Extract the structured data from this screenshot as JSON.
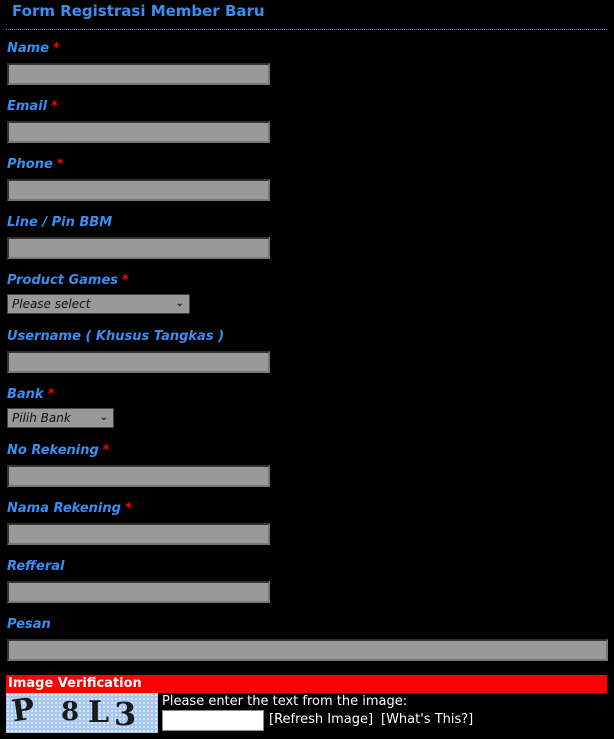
{
  "header": {
    "title": "Form Registrasi Member Baru"
  },
  "required_marker": "*",
  "fields": {
    "name": {
      "label": "Name",
      "required": true,
      "value": ""
    },
    "email": {
      "label": "Email",
      "required": true,
      "value": ""
    },
    "phone": {
      "label": "Phone",
      "required": true,
      "value": ""
    },
    "line_bbm": {
      "label": "Line / Pin BBM",
      "required": false,
      "value": ""
    },
    "product": {
      "label": "Product Games",
      "required": true,
      "selected": "Please select"
    },
    "username": {
      "label": "Username ( Khusus Tangkas )",
      "required": false,
      "value": ""
    },
    "bank": {
      "label": "Bank",
      "required": true,
      "selected": "Pilih Bank"
    },
    "no_rekening": {
      "label": "No Rekening",
      "required": true,
      "value": ""
    },
    "nama_rekening": {
      "label": "Nama Rekening",
      "required": true,
      "value": ""
    },
    "refferal": {
      "label": "Refferal",
      "required": false,
      "value": ""
    },
    "pesan": {
      "label": "Pesan",
      "required": false,
      "value": ""
    }
  },
  "verification": {
    "heading": "Image Verification",
    "captcha_chars": [
      "P",
      "8",
      "L",
      "3"
    ],
    "prompt": "Please enter the text from the image:",
    "input_value": "",
    "refresh_label": "[Refresh Image]",
    "whats_this_label": "[What's This?]"
  },
  "icons": {
    "dropdown": "chevron-down"
  },
  "colors": {
    "label": "#3a8ef0",
    "required": "#ff0000",
    "input_bg": "#999999",
    "verif_bar": "#ff0000"
  }
}
